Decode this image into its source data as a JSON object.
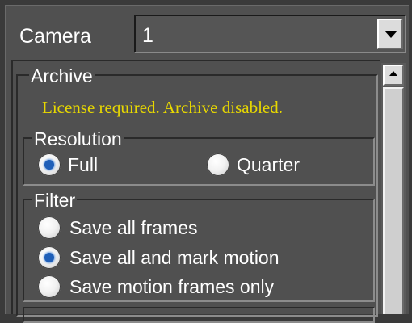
{
  "camera": {
    "label": "Camera",
    "value": "1"
  },
  "archive": {
    "title": "Archive",
    "warning": "License required. Archive disabled.",
    "warning_color": "#e8d800"
  },
  "resolution": {
    "title": "Resolution",
    "options": [
      {
        "label": "Full",
        "selected": true
      },
      {
        "label": "Quarter",
        "selected": false
      }
    ]
  },
  "filter": {
    "title": "Filter",
    "options": [
      {
        "label": "Save all frames",
        "selected": false
      },
      {
        "label": "Save all and mark motion",
        "selected": true
      },
      {
        "label": "Save motion frames only",
        "selected": false
      }
    ]
  },
  "icons": {
    "dropdown": "chevron-down-icon",
    "scroll_up": "arrow-up-icon"
  },
  "colors": {
    "panel_bg": "#505050",
    "radio_selected": "#1f5fb8"
  }
}
